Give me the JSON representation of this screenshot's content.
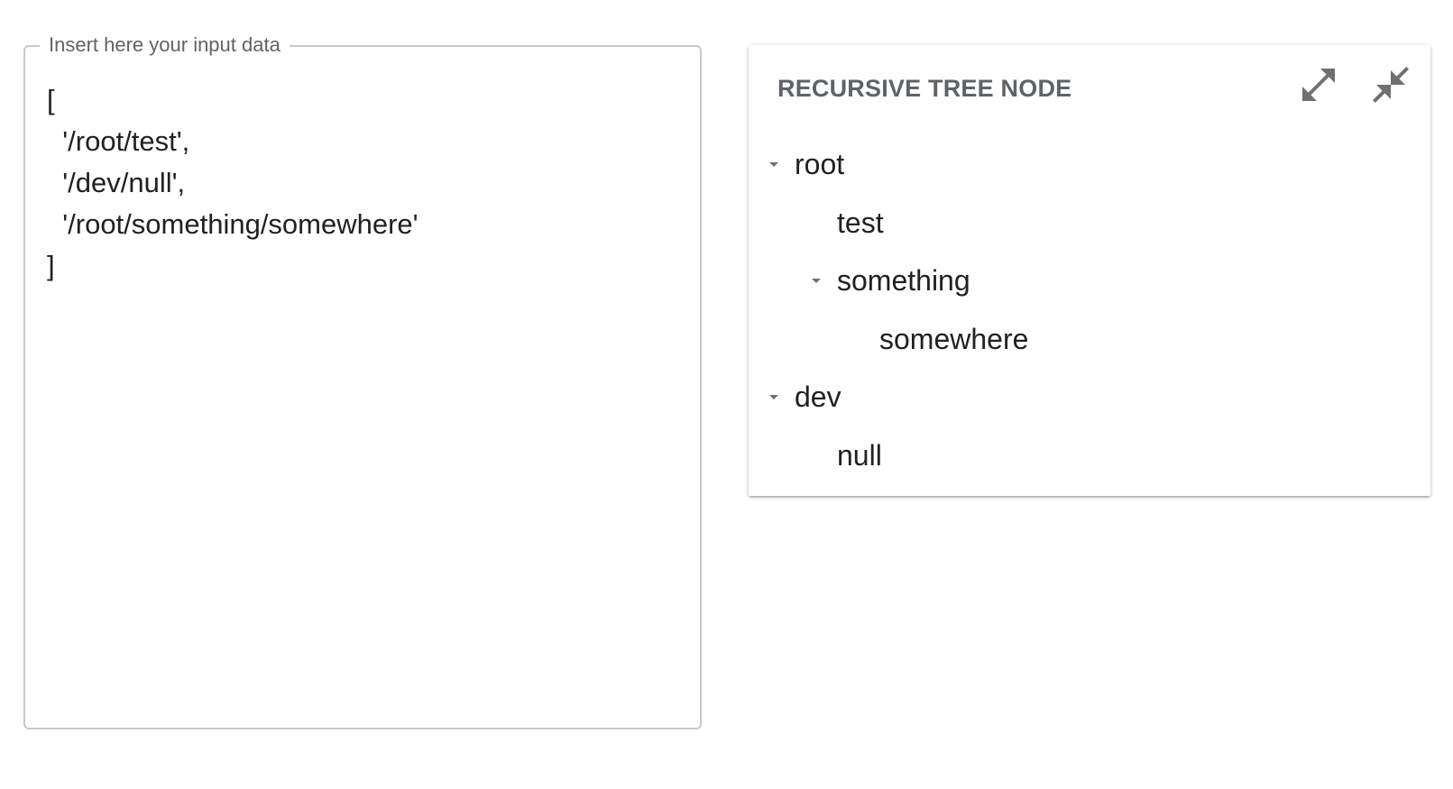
{
  "input": {
    "label": "Insert here your input data",
    "value": "[\n  '/root/test',\n  '/dev/null',\n  '/root/something/somewhere'\n]"
  },
  "card": {
    "title": "RECURSIVE TREE NODE",
    "actions": [
      {
        "icon": "expand-all-icon"
      },
      {
        "icon": "collapse-all-icon"
      }
    ]
  },
  "tree": {
    "nodes": [
      {
        "label": "root",
        "depth": 0,
        "expanded": true
      },
      {
        "label": "test",
        "depth": 1,
        "leaf": true
      },
      {
        "label": "something",
        "depth": 1,
        "expanded": true
      },
      {
        "label": "somewhere",
        "depth": 2,
        "leaf": true
      },
      {
        "label": "dev",
        "depth": 0,
        "expanded": true
      },
      {
        "label": "null",
        "depth": 1,
        "leaf": true
      }
    ]
  }
}
